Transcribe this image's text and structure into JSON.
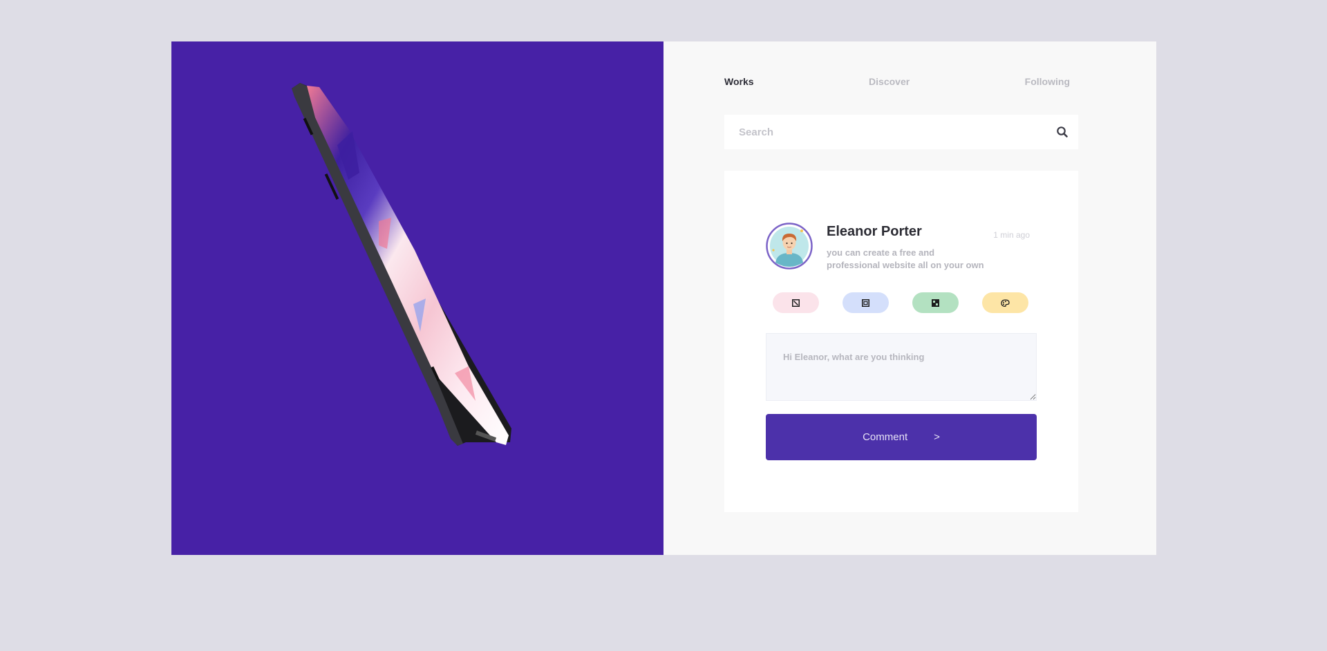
{
  "nav": {
    "items": [
      {
        "label": "Works",
        "active": true
      },
      {
        "label": "Discover",
        "active": false
      },
      {
        "label": "Following",
        "active": false
      }
    ]
  },
  "search": {
    "placeholder": "Search",
    "icon": "search-icon"
  },
  "post": {
    "author": "Eleanor Porter",
    "timestamp": "1 min ago",
    "description": "you can create a free and professional website all on your own",
    "avatar_icon": "avatar-illustration"
  },
  "actions": [
    {
      "icon": "image-icon",
      "color": "#fbe3ea"
    },
    {
      "icon": "frame-icon",
      "color": "#d4dffb"
    },
    {
      "icon": "grid-icon",
      "color": "#b3e1c1"
    },
    {
      "icon": "palette-icon",
      "color": "#fde5a6"
    }
  ],
  "comment": {
    "placeholder": "Hi Eleanor, what are you thinking",
    "button_label": "Comment",
    "button_arrow": ">"
  },
  "colors": {
    "page_bg": "#dedde6",
    "hero_bg": "#4721a6",
    "panel_bg": "#f8f8f8",
    "button": "#4c31aa"
  }
}
